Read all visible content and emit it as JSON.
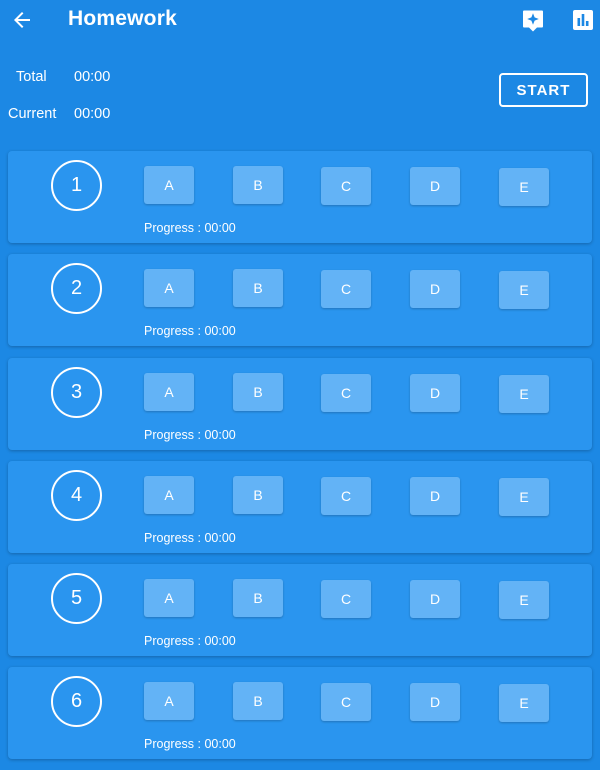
{
  "appbar": {
    "title": "Homework",
    "back_icon": "arrow-left-icon",
    "actions": [
      {
        "name": "ai-sparkle-button",
        "icon": "sparkle-chat-icon"
      },
      {
        "name": "stats-button",
        "icon": "bar-chart-icon"
      }
    ]
  },
  "timers": {
    "total_label": "Total",
    "total_value": "00:00",
    "current_label": "Current",
    "current_value": "00:00"
  },
  "start_label": "START",
  "options": [
    "A",
    "B",
    "C",
    "D",
    "E"
  ],
  "progress_label": "Progress",
  "questions": [
    {
      "number": "1",
      "progress": "00:00"
    },
    {
      "number": "2",
      "progress": "00:00"
    },
    {
      "number": "3",
      "progress": "00:00"
    },
    {
      "number": "4",
      "progress": "00:00"
    },
    {
      "number": "5",
      "progress": "00:00"
    },
    {
      "number": "6",
      "progress": "00:00"
    }
  ],
  "colors": {
    "background": "#1c88e4",
    "card": "#2a95ef",
    "option": "#63b3f6",
    "text": "#ffffff"
  }
}
